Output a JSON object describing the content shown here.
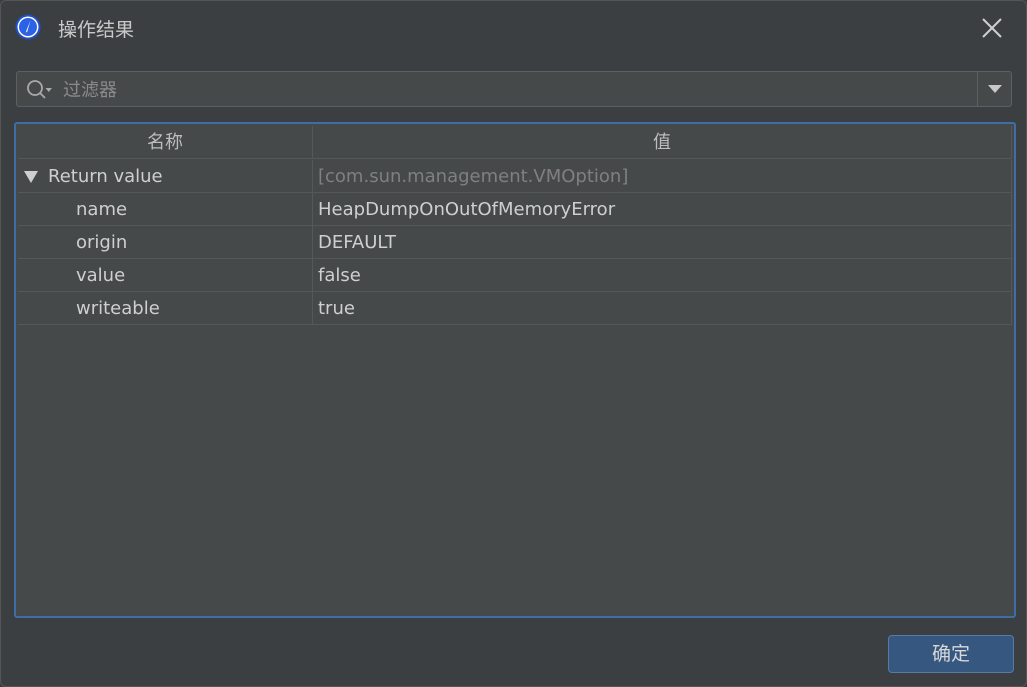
{
  "window": {
    "title": "操作结果"
  },
  "filter": {
    "placeholder": "过滤器",
    "value": ""
  },
  "table": {
    "columns": [
      "名称",
      "值"
    ],
    "root": {
      "name": "Return value",
      "value": "[com.sun.management.VMOption]",
      "expanded": true
    },
    "rows": [
      {
        "name": "name",
        "value": "HeapDumpOnOutOfMemoryError"
      },
      {
        "name": "origin",
        "value": "DEFAULT"
      },
      {
        "name": "value",
        "value": "false"
      },
      {
        "name": "writeable",
        "value": "true"
      }
    ]
  },
  "buttons": {
    "ok_label": "确定"
  },
  "colors": {
    "background": "#3c3f41",
    "accent": "#3d6fa6",
    "primary_button": "#365880"
  }
}
